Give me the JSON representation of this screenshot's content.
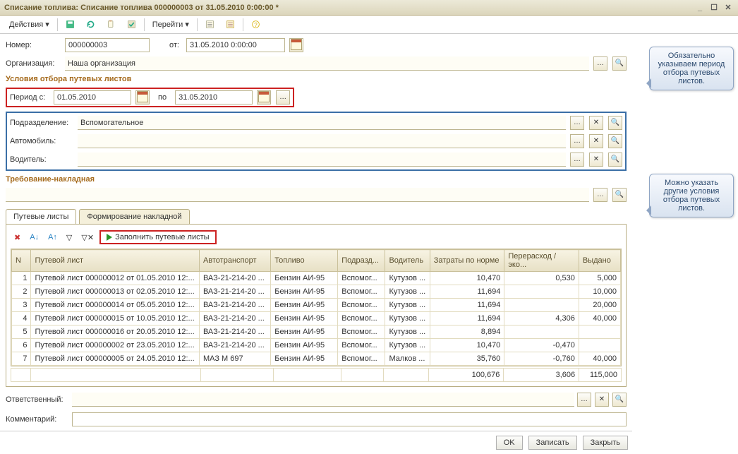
{
  "titlebar": {
    "title": "Списание топлива: Списание топлива 000000003 от 31.05.2010 0:00:00 *"
  },
  "toolbar": {
    "actions": "Действия",
    "goto": "Перейти"
  },
  "header": {
    "number_lbl": "Номер:",
    "number": "000000003",
    "from_lbl": "от:",
    "from": "31.05.2010  0:00:00",
    "org_lbl": "Организация:",
    "org": "Наша организация"
  },
  "section_filter": "Условия отбора путевых листов",
  "period": {
    "from_lbl": "Период с:",
    "from": "01.05.2010",
    "to_lbl": "по",
    "to": "31.05.2010"
  },
  "filter": {
    "dept_lbl": "Подразделение:",
    "dept": "Вспомогательное",
    "vehicle_lbl": "Автомобиль:",
    "driver_lbl": "Водитель:"
  },
  "section_req": "Требование-накладная",
  "tabs": {
    "t1": "Путевые листы",
    "t2": "Формирование накладной"
  },
  "fill_btn": "Заполнить путевые листы",
  "grid": {
    "cols": [
      "N",
      "Путевой лист",
      "Автотранспорт",
      "Топливо",
      "Подразд...",
      "Водитель",
      "Затраты по норме",
      "Перерасход / эко...",
      "Выдано"
    ],
    "rows": [
      {
        "n": "1",
        "wb": "Путевой лист 000000012 от 01.05.2010 12:...",
        "veh": "ВАЗ-21-214-20 ...",
        "fuel": "Бензин АИ-95",
        "dep": "Вспомог...",
        "drv": "Кутузов ...",
        "norm": "10,470",
        "over": "0,530",
        "iss": "5,000"
      },
      {
        "n": "2",
        "wb": "Путевой лист 000000013 от 02.05.2010 12:...",
        "veh": "ВАЗ-21-214-20 ...",
        "fuel": "Бензин АИ-95",
        "dep": "Вспомог...",
        "drv": "Кутузов ...",
        "norm": "11,694",
        "over": "",
        "iss": "10,000"
      },
      {
        "n": "3",
        "wb": "Путевой лист 000000014 от 05.05.2010 12:...",
        "veh": "ВАЗ-21-214-20 ...",
        "fuel": "Бензин АИ-95",
        "dep": "Вспомог...",
        "drv": "Кутузов ...",
        "norm": "11,694",
        "over": "",
        "iss": "20,000"
      },
      {
        "n": "4",
        "wb": "Путевой лист 000000015 от 10.05.2010 12:...",
        "veh": "ВАЗ-21-214-20 ...",
        "fuel": "Бензин АИ-95",
        "dep": "Вспомог...",
        "drv": "Кутузов ...",
        "norm": "11,694",
        "over": "4,306",
        "iss": "40,000"
      },
      {
        "n": "5",
        "wb": "Путевой лист 000000016 от 20.05.2010 12:...",
        "veh": "ВАЗ-21-214-20 ...",
        "fuel": "Бензин АИ-95",
        "dep": "Вспомог...",
        "drv": "Кутузов ...",
        "norm": "8,894",
        "over": "",
        "iss": ""
      },
      {
        "n": "6",
        "wb": "Путевой лист 000000002 от 23.05.2010 12:...",
        "veh": "ВАЗ-21-214-20 ...",
        "fuel": "Бензин АИ-95",
        "dep": "Вспомог...",
        "drv": "Кутузов ...",
        "norm": "10,470",
        "over": "-0,470",
        "iss": ""
      },
      {
        "n": "7",
        "wb": "Путевой лист 000000005 от 24.05.2010 12:...",
        "veh": "МАЗ М 697",
        "fuel": "Бензин АИ-95",
        "dep": "Вспомог...",
        "drv": "Малков ...",
        "norm": "35,760",
        "over": "-0,760",
        "iss": "40,000"
      }
    ],
    "totals": {
      "norm": "100,676",
      "over": "3,606",
      "iss": "115,000"
    }
  },
  "responsible_lbl": "Ответственный:",
  "comment_lbl": "Комментарий:",
  "buttons": {
    "ok": "OK",
    "apply": "Записать",
    "close": "Закрыть"
  },
  "callouts": {
    "c1": "Обязательно указываем период отбора путевых листов.",
    "c2": "Можно указать другие условия отбора путевых листов."
  }
}
